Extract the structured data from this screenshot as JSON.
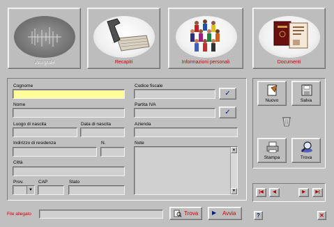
{
  "tabs": [
    {
      "label": "Anagrafe",
      "icon": "barcode-icon",
      "enabled": false
    },
    {
      "label": "Recapiti",
      "icon": "phone-keyboard-icon",
      "enabled": true
    },
    {
      "label": "Informazioni personali",
      "icon": "people-group-icon",
      "enabled": true
    },
    {
      "label": "Documenti",
      "icon": "passport-icon",
      "enabled": true
    }
  ],
  "form": {
    "cognome_label": "Cognome",
    "nome_label": "Nome",
    "luogo_label": "Luogo di nascita",
    "data_label": "Data di nascita",
    "indirizzo_label": "Indirizzo di residenza",
    "numero_label": "N.",
    "citta_label": "Città",
    "prov_label": "Prov.",
    "cap_label": "CAP",
    "stato_label": "Stato",
    "codice_label": "Codice fiscale",
    "partita_label": "Partita IVA",
    "azienda_label": "Azienda",
    "note_label": "Note",
    "check_glyph": "✓"
  },
  "toolbar": {
    "nuovo": "Nuovo",
    "salva": "Salva",
    "stampa": "Stampa",
    "trova": "Trova"
  },
  "nav": {
    "first": "|◀",
    "prev": "◀",
    "next": "▶",
    "last": "▶|"
  },
  "bottom": {
    "file_label": "File allegato",
    "trova_label": "Trova",
    "avvia_label": "Avvia",
    "help": "?",
    "close": "✕"
  },
  "colors": {
    "accent_red": "#cc0000",
    "focus_yellow": "#ffff99",
    "nav_blue": "#001a80"
  }
}
